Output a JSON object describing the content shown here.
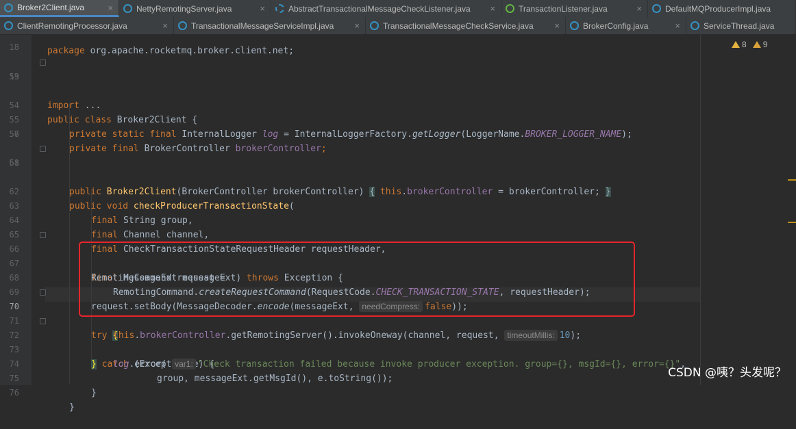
{
  "tabs_row1": [
    {
      "label": "Broker2Client.java",
      "icon": "class-icon",
      "active": true
    },
    {
      "label": "NettyRemotingServer.java",
      "icon": "class-icon",
      "active": false
    },
    {
      "label": "AbstractTransactionalMessageCheckListener.java",
      "icon": "abstract-class-icon",
      "active": false
    },
    {
      "label": "TransactionListener.java",
      "icon": "interface-icon",
      "active": false
    },
    {
      "label": "DefaultMQProducerImpl.java",
      "icon": "class-icon",
      "active": false
    }
  ],
  "tabs_row2": [
    {
      "label": "ClientRemotingProcessor.java",
      "icon": "class-icon"
    },
    {
      "label": "TransactionalMessageServiceImpl.java",
      "icon": "class-icon"
    },
    {
      "label": "TransactionalMessageCheckService.java",
      "icon": "class-icon"
    },
    {
      "label": "BrokerConfig.java",
      "icon": "class-icon"
    },
    {
      "label": "ServiceThread.java",
      "icon": "class-icon"
    }
  ],
  "close_glyph": "×",
  "inspections": {
    "warnings_a": "8",
    "warnings_b": "9",
    "warning_color": "#e3b341"
  },
  "line_numbers": [
    "18",
    "19",
    "53",
    "54",
    "55",
    "56",
    "57",
    "58",
    "61",
    "62",
    "63",
    "64",
    "65",
    "66",
    "67",
    "68",
    "69",
    "70",
    "71",
    "72",
    "73",
    "74",
    "75",
    "76"
  ],
  "code": {
    "l0": {
      "kw": "package",
      "rest": " org.apache.rocketmq.broker.client.net;"
    },
    "l1": {
      "kw": "import",
      "rest": " ..."
    },
    "l3": {
      "kw": "public class",
      "name": "Broker2Client",
      "rest": " {"
    },
    "l4": {
      "kw": "private static final",
      "type": " InternalLogger ",
      "field": "log",
      "eq": " = InternalLoggerFactory.",
      "method": "getLogger",
      "arg1": "(LoggerName.",
      "const": "BROKER_LOGGER_NAME",
      "end": ");"
    },
    "l5": {
      "kw": "private final",
      "type": " BrokerController ",
      "field": "brokerController",
      "end": ";"
    },
    "l7": {
      "kw": "public",
      "name": "Broker2Client",
      "params": "(BrokerController brokerController)",
      "open": "{",
      "this": "this",
      "dot": ".",
      "field": "brokerController",
      "rest": " = brokerController;",
      "close": "}"
    },
    "l9": {
      "kw": "public void",
      "name": "checkProducerTransactionState",
      "rest": "("
    },
    "l10": {
      "kw": "final",
      "rest": " String group,"
    },
    "l11": {
      "kw": "final",
      "rest": " Channel channel,"
    },
    "l12": {
      "kw": "final",
      "rest": " CheckTransactionStateRequestHeader requestHeader,"
    },
    "l13": {
      "kw": "final",
      "rest": " MessageExt messageExt) ",
      "kw2": "throws",
      "rest2": " Exception {"
    },
    "l14": {
      "rest": "RemotingCommand request ="
    },
    "l15": {
      "pre": "RemotingCommand.",
      "method": "createRequestCommand",
      "mid": "(RequestCode.",
      "const": "CHECK_TRANSACTION_STATE",
      "end": ", requestHeader);"
    },
    "l16": {
      "pre": "request.setBody(MessageDecoder.",
      "method": "encode",
      "mid": "(messageExt, ",
      "hint": "needCompress:",
      "kw": "false",
      "end": "));"
    },
    "l17": {
      "kw": "try",
      "brace": "{"
    },
    "l18": {
      "this": "this",
      "dot": ".",
      "field": "brokerController",
      "mid": ".getRemotingServer().invokeOneway(channel, request, ",
      "hint": "timeoutMillis:",
      "num": "10",
      "end": ");"
    },
    "l19": {
      "brace": "}",
      "kw": " catch",
      "rest": " (Exception e) {"
    },
    "l20": {
      "field": "log",
      "mid": ".error( ",
      "hint": "var1:",
      "str": "\"Check transaction failed because invoke producer exception. group={}, msgId={}, error={}\"",
      "end": ","
    },
    "l21": {
      "rest": "group, messageExt.getMsgId(), e.toString());"
    },
    "l22": {
      "rest": "}"
    },
    "l23": {
      "rest": "}"
    }
  },
  "watermark": "CSDN @咦？头发呢？",
  "highlight_color": "#e8252b"
}
